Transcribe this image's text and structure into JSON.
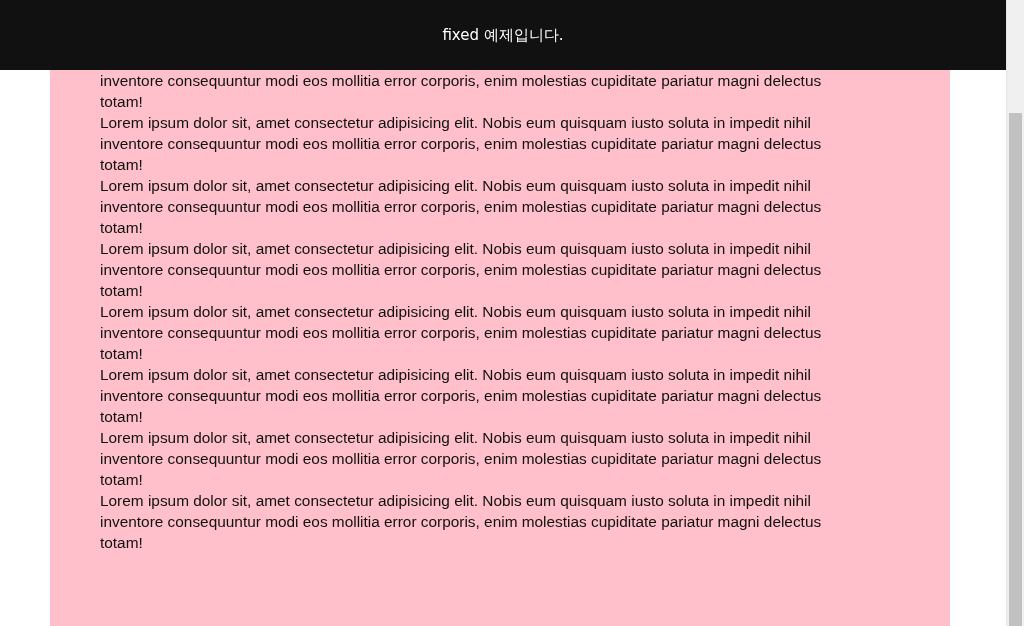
{
  "header": {
    "title": "fixed 예제입니다."
  },
  "paragraphs": [
    {
      "lines": [
        "inventore consequuntur modi eos mollitia error corporis, enim molestias cupiditate pariatur magni delectus",
        "totam!"
      ]
    },
    {
      "lines": [
        "Lorem ipsum dolor sit, amet consectetur adipisicing elit. Nobis eum quisquam iusto soluta in impedit nihil",
        "inventore consequuntur modi eos mollitia error corporis, enim molestias cupiditate pariatur magni delectus",
        "totam!"
      ]
    },
    {
      "lines": [
        "Lorem ipsum dolor sit, amet consectetur adipisicing elit. Nobis eum quisquam iusto soluta in impedit nihil",
        "inventore consequuntur modi eos mollitia error corporis, enim molestias cupiditate pariatur magni delectus",
        "totam!"
      ]
    },
    {
      "lines": [
        "Lorem ipsum dolor sit, amet consectetur adipisicing elit. Nobis eum quisquam iusto soluta in impedit nihil",
        "inventore consequuntur modi eos mollitia error corporis, enim molestias cupiditate pariatur magni delectus",
        "totam!"
      ]
    },
    {
      "lines": [
        "Lorem ipsum dolor sit, amet consectetur adipisicing elit. Nobis eum quisquam iusto soluta in impedit nihil",
        "inventore consequuntur modi eos mollitia error corporis, enim molestias cupiditate pariatur magni delectus",
        "totam!"
      ]
    },
    {
      "lines": [
        "Lorem ipsum dolor sit, amet consectetur adipisicing elit. Nobis eum quisquam iusto soluta in impedit nihil",
        "inventore consequuntur modi eos mollitia error corporis, enim molestias cupiditate pariatur magni delectus",
        "totam!"
      ]
    },
    {
      "lines": [
        "Lorem ipsum dolor sit, amet consectetur adipisicing elit. Nobis eum quisquam iusto soluta in impedit nihil",
        "inventore consequuntur modi eos mollitia error corporis, enim molestias cupiditate pariatur magni delectus",
        "totam!"
      ]
    },
    {
      "lines": [
        "Lorem ipsum dolor sit, amet consectetur adipisicing elit. Nobis eum quisquam iusto soluta in impedit nihil",
        "inventore consequuntur modi eos mollitia error corporis, enim molestias cupiditate pariatur magni delectus",
        "totam!"
      ]
    }
  ]
}
